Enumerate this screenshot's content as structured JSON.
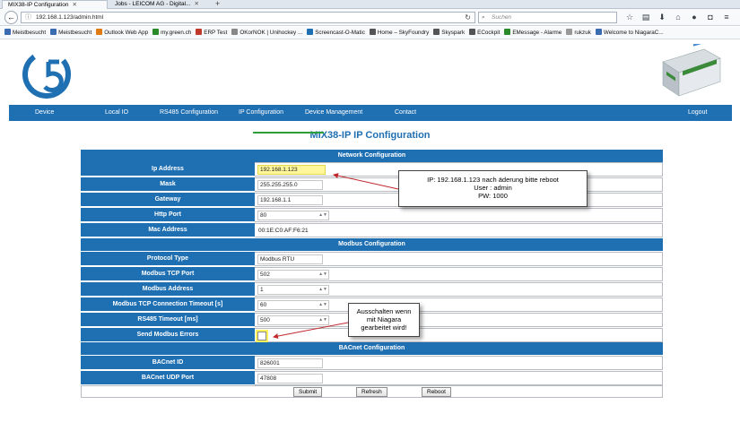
{
  "browser": {
    "tabs": [
      {
        "label": "MIX38-IP Configuration",
        "active": true
      },
      {
        "label": "Jobs - LEICOM AG - Digital...",
        "active": false
      }
    ],
    "url": "192.168.1.123/admin.html",
    "search_placeholder": "Suchen",
    "bookmarks": [
      {
        "label": "Meistbesucht",
        "color": "#3b6bb0"
      },
      {
        "label": "Meistbesucht",
        "color": "#3b6bb0"
      },
      {
        "label": "Outlook Web App",
        "color": "#e07a12"
      },
      {
        "label": "my.green.ch",
        "color": "#2a8a2a"
      },
      {
        "label": "ERP Test",
        "color": "#c0392b"
      },
      {
        "label": "OKorNOK | Unihockey ...",
        "color": "#888888"
      },
      {
        "label": "Screencast-O-Matic",
        "color": "#1f6fb3"
      },
      {
        "label": "Home – SkyFoundry",
        "color": "#555555"
      },
      {
        "label": "Skyspark",
        "color": "#555555"
      },
      {
        "label": "ECockpit",
        "color": "#555555"
      },
      {
        "label": "EMessage - Alarme",
        "color": "#2a8a2a"
      },
      {
        "label": "rukzuk",
        "color": "#999999"
      },
      {
        "label": "Welcome to NiagaraC...",
        "color": "#3b6bb0"
      }
    ]
  },
  "menu": {
    "items": [
      "Device",
      "Local IO",
      "RS485 Configuration",
      "IP Configuration",
      "Device Management",
      "Contact"
    ],
    "logout": "Logout"
  },
  "page_title": "MIX38-IP IP Configuration",
  "sections": {
    "network": "Network Configuration",
    "modbus": "Modbus Configuration",
    "bacnet": "BACnet Configuration"
  },
  "network": {
    "ip_label": "Ip Address",
    "ip_value": "192.168.1.123",
    "mask_label": "Mask",
    "mask_value": "255.255.255.0",
    "gateway_label": "Gateway",
    "gateway_value": "192.168.1.1",
    "http_label": "Http Port",
    "http_value": "80",
    "mac_label": "Mac Address",
    "mac_value": "00:1E:C0:AF:F6:21"
  },
  "modbus": {
    "protocol_label": "Protocol Type",
    "protocol_value": "Modbus RTU",
    "tcp_port_label": "Modbus TCP Port",
    "tcp_port_value": "502",
    "address_label": "Modbus Address",
    "address_value": "1",
    "timeout_label": "Modbus TCP Connection Timeout [s]",
    "timeout_value": "60",
    "rs485_label": "RS485 Timeout [ms]",
    "rs485_value": "500",
    "errors_label": "Send Modbus Errors",
    "errors_checked": false
  },
  "bacnet": {
    "id_label": "BACnet ID",
    "id_value": "826001",
    "udp_label": "BACnet UDP Port",
    "udp_value": "47808"
  },
  "buttons": {
    "submit": "Submit",
    "refresh": "Refresh",
    "reboot": "Reboot"
  },
  "callouts": {
    "ip_note": [
      "IP: 192.168.1.123 nach äderung bitte reboot",
      "User : admin",
      "PW: 1000"
    ],
    "modbus_note": [
      "Ausschalten wenn",
      "mit Niagara",
      "gearbeitet wird!"
    ]
  }
}
